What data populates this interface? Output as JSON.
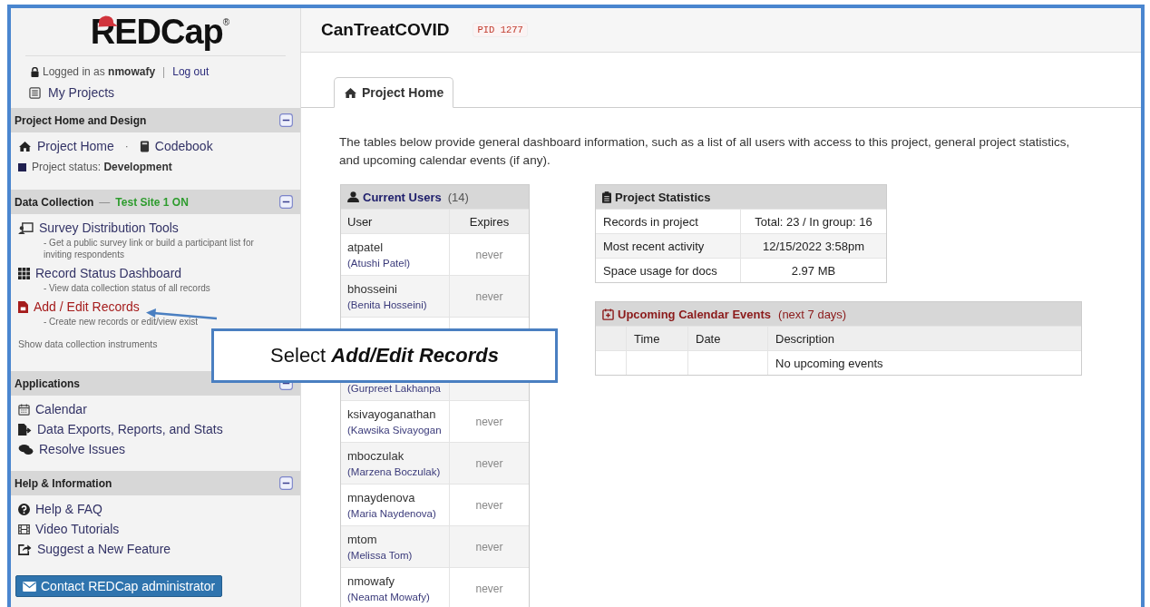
{
  "logo": {
    "text": "REDCap",
    "mark": "®"
  },
  "account": {
    "prefix": "Logged in as",
    "user": "nmowafy",
    "separator": "|",
    "logout": "Log out",
    "my_projects": "My Projects"
  },
  "sidebar": {
    "sections": [
      {
        "title": "Project Home and Design",
        "expanded": true,
        "items": [
          {
            "kind": "links",
            "links": [
              {
                "label": "Project Home"
              },
              {
                "label": "Codebook"
              }
            ],
            "separator": "·"
          },
          {
            "kind": "status",
            "label": "Project status:",
            "value": "Development"
          }
        ]
      },
      {
        "title": "Data Collection",
        "dash": "—",
        "site": "Test Site 1 ON",
        "expanded": true,
        "items": [
          {
            "kind": "link",
            "label": "Survey Distribution Tools",
            "note": "- Get a public survey link or build a participant list for inviting respondents",
            "selected": false
          },
          {
            "kind": "link",
            "label": "Record Status Dashboard",
            "note": "- View data collection status of all records",
            "selected": false
          },
          {
            "kind": "link",
            "label": "Add / Edit Records",
            "note": "- Create new records or edit/view exist",
            "selected": true
          },
          {
            "kind": "plain",
            "label": "Show data collection instruments"
          }
        ]
      },
      {
        "title": "Applications",
        "expanded": true,
        "items": [
          {
            "kind": "link",
            "label": "Calendar",
            "selected": false
          },
          {
            "kind": "link",
            "label": "Data Exports, Reports, and Stats",
            "selected": false
          },
          {
            "kind": "link",
            "label": "Resolve Issues",
            "selected": false
          }
        ]
      },
      {
        "title": "Help & Information",
        "expanded": true,
        "items": [
          {
            "kind": "link",
            "label": "Help & FAQ",
            "selected": false
          },
          {
            "kind": "link",
            "label": "Video Tutorials",
            "selected": false
          },
          {
            "kind": "link",
            "label": "Suggest a New Feature",
            "selected": false
          }
        ]
      }
    ],
    "contact_button": "Contact REDCap administrator"
  },
  "header": {
    "title": "CanTreatCOVID",
    "pid": "PID 1277"
  },
  "tabs": [
    {
      "label": "Project Home",
      "selected": true
    }
  ],
  "intro": "The tables below provide general dashboard information, such as a list of all users with access to this project, general project statistics, and upcoming calendar events (if any).",
  "users": {
    "title": "Current Users",
    "count": "(14)",
    "columns": [
      "User",
      "Expires"
    ],
    "rows": [
      {
        "kind": "user",
        "user": "atpatel",
        "name": "(Atushi Patel)",
        "expires": "never"
      },
      {
        "kind": "user",
        "user": "bhosseini",
        "name": "(Benita Hosseini)",
        "expires": "never"
      },
      {
        "kind": "covered"
      },
      {
        "kind": "user",
        "name": "(Gurpreet Lakhanpa"
      },
      {
        "kind": "user",
        "user": "ksivayoganathan",
        "name": "(Kawsika Sivayogan",
        "expires": "never"
      },
      {
        "kind": "user",
        "user": "mboczulak",
        "name": "(Marzena Boczulak)",
        "expires": "never"
      },
      {
        "kind": "user",
        "user": "mnaydenova",
        "name": "(Maria Naydenova)",
        "expires": "never"
      },
      {
        "kind": "user",
        "user": "mtom",
        "name": "(Melissa Tom)",
        "expires": "never"
      },
      {
        "kind": "user",
        "user": "nmowafy",
        "name": "(Neamat Mowafy)",
        "expires": "never"
      }
    ]
  },
  "stats": {
    "title": "Project Statistics",
    "rows": [
      [
        "Records in project",
        "Total: 23 / In group: 16"
      ],
      [
        "Most recent activity",
        "12/15/2022 3:58pm"
      ],
      [
        "Space usage for docs",
        "2.97 MB"
      ]
    ]
  },
  "calendar": {
    "title": "Upcoming Calendar Events",
    "note": "(next 7 days)",
    "columns": [
      "Time",
      "Date",
      "Description"
    ],
    "empty": "No upcoming events"
  },
  "callout": {
    "lead": "Select",
    "emphasis": "Add/Edit Records"
  }
}
